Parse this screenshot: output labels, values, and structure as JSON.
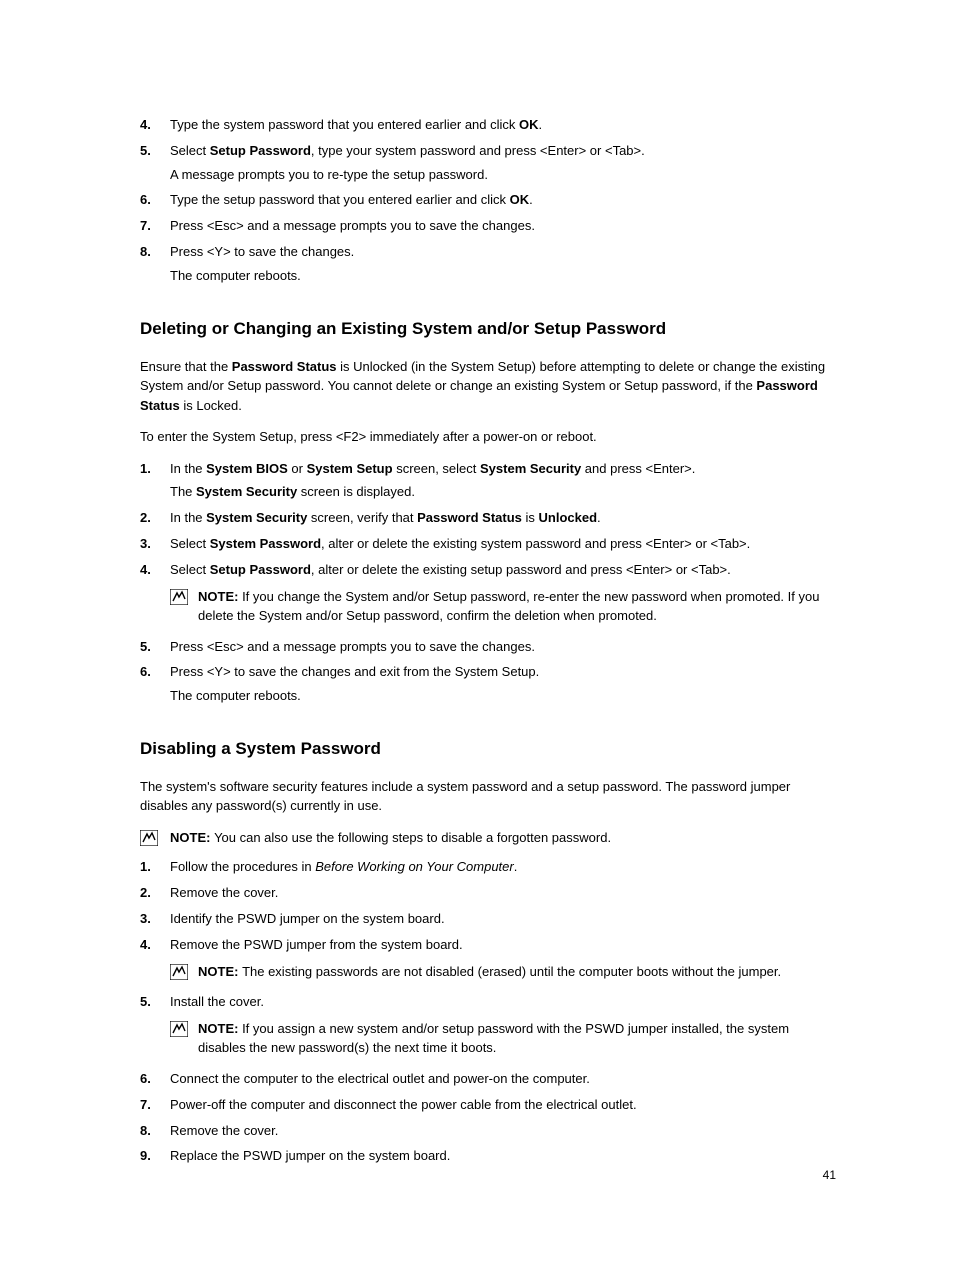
{
  "section1": {
    "steps": [
      {
        "n": "4.",
        "parts": [
          {
            "t": "Type the system password that you entered earlier and click "
          },
          {
            "t": "OK",
            "b": true
          },
          {
            "t": "."
          }
        ]
      },
      {
        "n": "5.",
        "parts": [
          {
            "t": "Select "
          },
          {
            "t": "Setup Password",
            "b": true
          },
          {
            "t": ", type your system password and press <Enter> or <Tab>."
          }
        ],
        "sub": "A message prompts you to re-type the setup password."
      },
      {
        "n": "6.",
        "parts": [
          {
            "t": "Type the setup password that you entered earlier and click "
          },
          {
            "t": "OK",
            "b": true
          },
          {
            "t": "."
          }
        ]
      },
      {
        "n": "7.",
        "parts": [
          {
            "t": "Press <Esc> and a message prompts you to save the changes."
          }
        ]
      },
      {
        "n": "8.",
        "parts": [
          {
            "t": "Press <Y> to save the changes."
          }
        ],
        "sub": "The computer reboots."
      }
    ]
  },
  "section2": {
    "heading": "Deleting or Changing an Existing System and/or Setup Password",
    "intro1": [
      {
        "t": "Ensure that the "
      },
      {
        "t": "Password Status",
        "b": true
      },
      {
        "t": " is Unlocked (in the System Setup) before attempting to delete or change the existing System and/or Setup password. You cannot delete or change an existing System or Setup password, if the "
      },
      {
        "t": "Password Status",
        "b": true
      },
      {
        "t": " is Locked."
      }
    ],
    "intro2": "To enter the System Setup, press <F2> immediately after a power-on or reboot.",
    "steps": [
      {
        "n": "1.",
        "parts": [
          {
            "t": "In the "
          },
          {
            "t": "System BIOS",
            "b": true
          },
          {
            "t": " or "
          },
          {
            "t": "System Setup",
            "b": true
          },
          {
            "t": " screen, select "
          },
          {
            "t": "System Security",
            "b": true
          },
          {
            "t": " and press <Enter>."
          }
        ],
        "subparts": [
          {
            "t": "The "
          },
          {
            "t": "System Security",
            "b": true
          },
          {
            "t": " screen is displayed."
          }
        ]
      },
      {
        "n": "2.",
        "parts": [
          {
            "t": "In the "
          },
          {
            "t": "System Security",
            "b": true
          },
          {
            "t": " screen, verify that "
          },
          {
            "t": "Password Status",
            "b": true
          },
          {
            "t": " is "
          },
          {
            "t": "Unlocked",
            "b": true
          },
          {
            "t": "."
          }
        ]
      },
      {
        "n": "3.",
        "parts": [
          {
            "t": "Select "
          },
          {
            "t": "System Password",
            "b": true
          },
          {
            "t": ", alter or delete the existing system password and press <Enter> or <Tab>."
          }
        ]
      },
      {
        "n": "4.",
        "parts": [
          {
            "t": "Select "
          },
          {
            "t": "Setup Password",
            "b": true
          },
          {
            "t": ", alter or delete the existing setup password and press <Enter> or <Tab>."
          }
        ],
        "note": [
          {
            "t": "NOTE: ",
            "b": true
          },
          {
            "t": "If you change the System and/or Setup password, re-enter the new password when promoted. If you delete the System and/or Setup password, confirm the deletion when promoted."
          }
        ]
      },
      {
        "n": "5.",
        "parts": [
          {
            "t": "Press <Esc> and a message prompts you to save the changes."
          }
        ]
      },
      {
        "n": "6.",
        "parts": [
          {
            "t": "Press <Y> to save the changes and exit from the System Setup."
          }
        ],
        "sub": "The computer reboots."
      }
    ]
  },
  "section3": {
    "heading": "Disabling a System Password",
    "intro": "The system's software security features include a system password and a setup password. The password jumper disables any password(s) currently in use.",
    "topnote": [
      {
        "t": "NOTE: ",
        "b": true
      },
      {
        "t": "You can also use the following steps to disable a forgotten password."
      }
    ],
    "steps": [
      {
        "n": "1.",
        "parts": [
          {
            "t": "Follow the procedures in "
          },
          {
            "t": "Before Working on Your Computer",
            "i": true
          },
          {
            "t": "."
          }
        ]
      },
      {
        "n": "2.",
        "parts": [
          {
            "t": "Remove the cover."
          }
        ]
      },
      {
        "n": "3.",
        "parts": [
          {
            "t": "Identify the PSWD jumper on the system board."
          }
        ]
      },
      {
        "n": "4.",
        "parts": [
          {
            "t": "Remove the PSWD jumper from the system board."
          }
        ],
        "note": [
          {
            "t": "NOTE: ",
            "b": true
          },
          {
            "t": "The existing passwords are not disabled (erased) until the computer boots without the jumper."
          }
        ]
      },
      {
        "n": "5.",
        "parts": [
          {
            "t": "Install the cover."
          }
        ],
        "note": [
          {
            "t": "NOTE: ",
            "b": true
          },
          {
            "t": "If you assign a new system and/or setup password with the PSWD jumper installed, the system disables the new password(s) the next time it boots."
          }
        ]
      },
      {
        "n": "6.",
        "parts": [
          {
            "t": "Connect the computer to the electrical outlet and power-on the computer."
          }
        ]
      },
      {
        "n": "7.",
        "parts": [
          {
            "t": "Power-off the computer and disconnect the power cable from the electrical outlet."
          }
        ]
      },
      {
        "n": "8.",
        "parts": [
          {
            "t": "Remove the cover."
          }
        ]
      },
      {
        "n": "9.",
        "parts": [
          {
            "t": "Replace the PSWD jumper on the system board."
          }
        ]
      }
    ]
  },
  "pagenum": "41"
}
